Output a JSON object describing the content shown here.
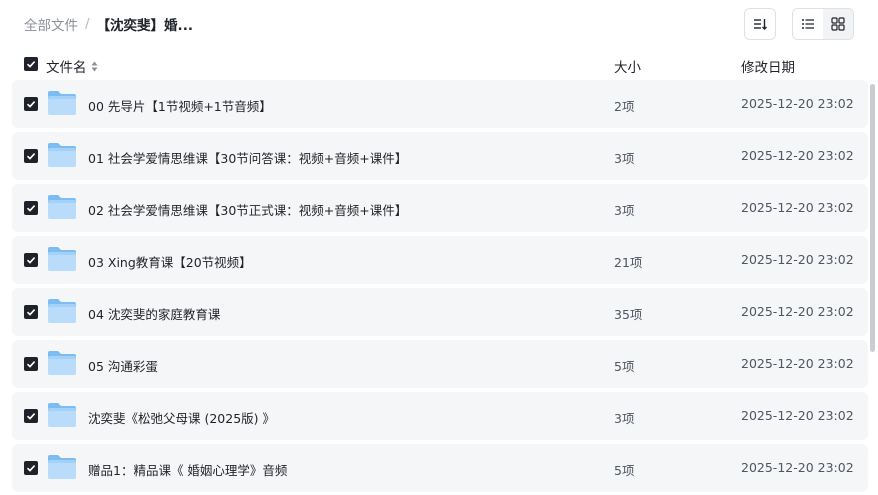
{
  "breadcrumb": {
    "root": "全部文件",
    "separator": "/",
    "current": "【沈奕斐】婚..."
  },
  "toolbar": {
    "sort_icon": "sort-list-icon",
    "list_view_icon": "list-view-icon",
    "grid_view_icon": "grid-view-icon"
  },
  "table": {
    "header": {
      "name": "文件名",
      "size": "大小",
      "date": "修改日期"
    },
    "rows": [
      {
        "name": "00 先导片【1节视频+1节音频】",
        "size": "2项",
        "date": "2025-12-20 23:02"
      },
      {
        "name": "01 社会学爱情思维课【30节问答课：视频+音频+课件】",
        "size": "3项",
        "date": "2025-12-20 23:02"
      },
      {
        "name": "02 社会学爱情思维课【30节正式课：视频+音频+课件】",
        "size": "3项",
        "date": "2025-12-20 23:02"
      },
      {
        "name": "03 Xing教育课【20节视频】",
        "size": "21项",
        "date": "2025-12-20 23:02"
      },
      {
        "name": "04 沈奕斐的家庭教育课",
        "size": "35项",
        "date": "2025-12-20 23:02"
      },
      {
        "name": "05 沟通彩蛋",
        "size": "5项",
        "date": "2025-12-20 23:02"
      },
      {
        "name": "沈奕斐《松弛父母课 (2025版) 》",
        "size": "3项",
        "date": "2025-12-20 23:02"
      },
      {
        "name": "赠品1：精品课《 婚姻心理学》音频",
        "size": "5项",
        "date": "2025-12-20 23:02"
      }
    ]
  },
  "colors": {
    "checkbox": "#1f2329",
    "row_bg": "#f5f6f7",
    "folder_light": "#b8dcfa",
    "folder_dark": "#7bbcf2"
  }
}
